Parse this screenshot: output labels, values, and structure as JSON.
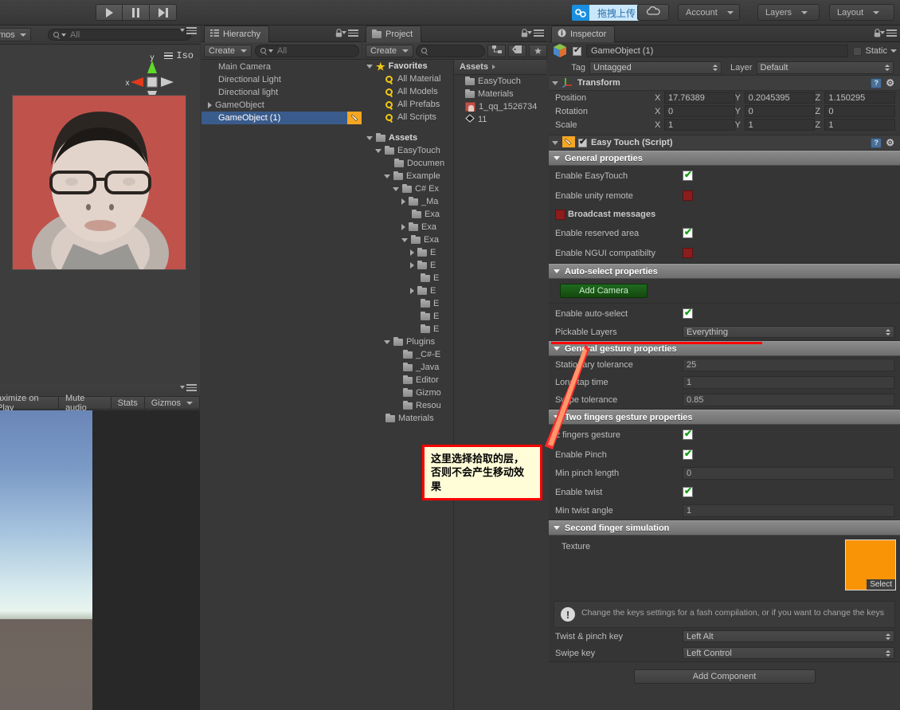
{
  "toolbar": {
    "play_icon": "play-icon",
    "pause_icon": "pause-icon",
    "step_icon": "step-icon",
    "upload_label": "拖拽上传",
    "upload_icon": "link-chain-icon",
    "cloud_icon": "cloud-icon",
    "account_label": "Account",
    "layers_label": "Layers",
    "layout_label": "Layout"
  },
  "scene_view": {
    "gizmos_label": "mos",
    "search_placeholder": "All",
    "view_mode": "Iso",
    "axis_x": "x",
    "axis_y": "y"
  },
  "game_view": {
    "buttons": [
      "aximize on Play",
      "Mute audio",
      "Stats",
      "Gizmos"
    ]
  },
  "hierarchy": {
    "tab_label": "Hierarchy",
    "create_label": "Create",
    "search_placeholder": "All",
    "items": [
      {
        "label": "Main Camera",
        "indent": 0,
        "expandable": false,
        "selected": false
      },
      {
        "label": "Directional Light",
        "indent": 0,
        "expandable": false,
        "selected": false
      },
      {
        "label": "Directional light",
        "indent": 0,
        "expandable": false,
        "selected": false
      },
      {
        "label": "GameObject",
        "indent": 0,
        "expandable": true,
        "selected": false
      },
      {
        "label": "GameObject (1)",
        "indent": 0,
        "expandable": false,
        "selected": true
      }
    ]
  },
  "project": {
    "tab_label": "Project",
    "create_label": "Create",
    "search_placeholder": "",
    "icon_buttons": [
      "dependency-icon",
      "label-tag-icon",
      "favorite-star-icon"
    ],
    "left_tree": [
      {
        "label": "Favorites",
        "indent": 0,
        "kind": "star",
        "arrow": "down",
        "bold": true
      },
      {
        "label": "All Material",
        "indent": 1,
        "kind": "search",
        "arrow": "none",
        "bold": false
      },
      {
        "label": "All Models",
        "indent": 1,
        "kind": "search",
        "arrow": "none",
        "bold": false
      },
      {
        "label": "All Prefabs",
        "indent": 1,
        "kind": "search",
        "arrow": "none",
        "bold": false
      },
      {
        "label": "All Scripts",
        "indent": 1,
        "kind": "search",
        "arrow": "none",
        "bold": false
      },
      {
        "label": "",
        "indent": 0,
        "kind": "spacer",
        "arrow": "none",
        "bold": false
      },
      {
        "label": "Assets",
        "indent": 0,
        "kind": "folder",
        "arrow": "down",
        "bold": true
      },
      {
        "label": "EasyTouch",
        "indent": 1,
        "kind": "folder",
        "arrow": "down",
        "bold": false
      },
      {
        "label": "Documen",
        "indent": 2,
        "kind": "folder",
        "arrow": "none",
        "bold": false
      },
      {
        "label": "Example",
        "indent": 2,
        "kind": "folder",
        "arrow": "down",
        "bold": false
      },
      {
        "label": "C# Ex",
        "indent": 3,
        "kind": "folder",
        "arrow": "down",
        "bold": false
      },
      {
        "label": "_Ma",
        "indent": 4,
        "kind": "folder",
        "arrow": "right",
        "bold": false
      },
      {
        "label": "Exa",
        "indent": 4,
        "kind": "folder",
        "arrow": "none",
        "bold": false
      },
      {
        "label": "Exa",
        "indent": 4,
        "kind": "folder",
        "arrow": "right",
        "bold": false
      },
      {
        "label": "Exa",
        "indent": 4,
        "kind": "folder",
        "arrow": "down",
        "bold": false
      },
      {
        "label": "E",
        "indent": 5,
        "kind": "folder",
        "arrow": "right",
        "bold": false
      },
      {
        "label": "E",
        "indent": 5,
        "kind": "folder",
        "arrow": "right",
        "bold": false
      },
      {
        "label": "E",
        "indent": 5,
        "kind": "folder",
        "arrow": "none",
        "bold": false
      },
      {
        "label": "E",
        "indent": 5,
        "kind": "folder",
        "arrow": "right",
        "bold": false
      },
      {
        "label": "E",
        "indent": 5,
        "kind": "folder",
        "arrow": "none",
        "bold": false
      },
      {
        "label": "E",
        "indent": 5,
        "kind": "folder",
        "arrow": "none",
        "bold": false
      },
      {
        "label": "E",
        "indent": 5,
        "kind": "folder",
        "arrow": "none",
        "bold": false
      },
      {
        "label": "Plugins",
        "indent": 2,
        "kind": "folder",
        "arrow": "down",
        "bold": false
      },
      {
        "label": "_C#-E",
        "indent": 3,
        "kind": "folder",
        "arrow": "none",
        "bold": false
      },
      {
        "label": "_Java",
        "indent": 3,
        "kind": "folder",
        "arrow": "none",
        "bold": false
      },
      {
        "label": "Editor",
        "indent": 3,
        "kind": "folder",
        "arrow": "none",
        "bold": false
      },
      {
        "label": "Gizmo",
        "indent": 3,
        "kind": "folder",
        "arrow": "none",
        "bold": false
      },
      {
        "label": "Resou",
        "indent": 3,
        "kind": "folder",
        "arrow": "none",
        "bold": false
      },
      {
        "label": "Materials",
        "indent": 1,
        "kind": "folder",
        "arrow": "none",
        "bold": false
      }
    ],
    "breadcrumb": "Assets",
    "assets": [
      {
        "label": "EasyTouch",
        "kind": "folder"
      },
      {
        "label": "Materials",
        "kind": "folder"
      },
      {
        "label": "1_qq_1526734",
        "kind": "image"
      },
      {
        "label": "11",
        "kind": "scene"
      }
    ]
  },
  "inspector": {
    "tab_label": "Inspector",
    "object_name": "GameObject (1)",
    "object_enabled": true,
    "static_label": "Static",
    "tag_label": "Tag",
    "tag_value": "Untagged",
    "layer_label": "Layer",
    "layer_value": "Default",
    "transform": {
      "title": "Transform",
      "rows": [
        {
          "label": "Position",
          "x": "17.76389",
          "y": "0.2045395",
          "z": "1.150295"
        },
        {
          "label": "Rotation",
          "x": "0",
          "y": "0",
          "z": "0"
        },
        {
          "label": "Scale",
          "x": "1",
          "y": "1",
          "z": "1"
        }
      ],
      "axis_labels": [
        "X",
        "Y",
        "Z"
      ]
    },
    "easytouch": {
      "title": "Easy Touch (Script)",
      "enabled": true,
      "sections": [
        {
          "title": "General properties",
          "rows": [
            {
              "label": "Enable EasyTouch",
              "type": "check",
              "value": true
            },
            {
              "label": "Enable unity remote",
              "type": "check",
              "value": false
            },
            {
              "label": "Broadcast messages",
              "type": "check-left",
              "value": false
            },
            {
              "label": "Enable reserved area",
              "type": "check",
              "value": true
            },
            {
              "label": "Enable NGUI compatibilty",
              "type": "check",
              "value": false
            }
          ]
        },
        {
          "title": "Auto-select properties",
          "button_label": "Add Camera",
          "rows": [
            {
              "label": "Enable auto-select",
              "type": "check",
              "value": true
            },
            {
              "label": "Pickable Layers",
              "type": "dropdown",
              "value": "Everything"
            }
          ]
        },
        {
          "title": "General gesture properties",
          "rows": [
            {
              "label": "Stationary tolerance",
              "type": "text",
              "value": "25"
            },
            {
              "label": "Long tap time",
              "type": "text",
              "value": "1"
            },
            {
              "label": "Swipe tolerance",
              "type": "text",
              "value": "0.85"
            }
          ]
        },
        {
          "title": "Two fingers gesture properties",
          "rows": [
            {
              "label": "2 fingers gesture",
              "type": "check",
              "value": true
            },
            {
              "label": "Enable Pinch",
              "type": "check",
              "value": true
            },
            {
              "label": "Min pinch length",
              "type": "text",
              "value": "0"
            },
            {
              "label": "Enable twist",
              "type": "check",
              "value": true
            },
            {
              "label": "Min twist angle",
              "type": "text",
              "value": "1"
            }
          ]
        },
        {
          "title": "Second finger simulation",
          "texture_label": "Texture",
          "texture_select_label": "Select",
          "texture_color": "#f89406",
          "info_text": "Change the keys settings for a fash compilation, or if you want to change the keys",
          "rows": [
            {
              "label": "Twist & pinch key",
              "type": "dropdown",
              "value": "Left Alt"
            },
            {
              "label": "Swipe key",
              "type": "dropdown",
              "value": "Left Control"
            }
          ]
        }
      ]
    },
    "add_component_label": "Add Component"
  },
  "annotation": {
    "callout_text": "这里选择拾取的层，否则不会产生移动效果",
    "highlight_color": "#ff0000"
  }
}
